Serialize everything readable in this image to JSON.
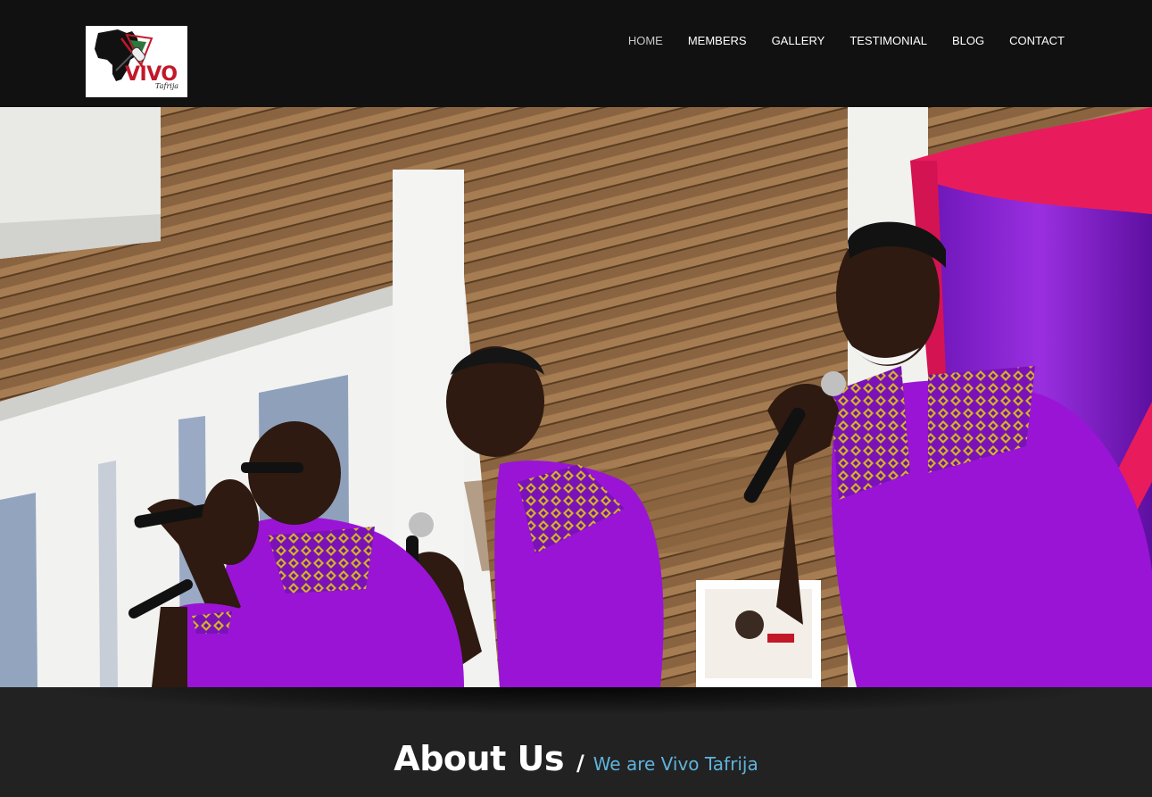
{
  "logo": {
    "brand": "VIVO",
    "sub": "Tafrija"
  },
  "nav": {
    "items": [
      {
        "label": "HOME",
        "active": true
      },
      {
        "label": "MEMBERS",
        "active": false
      },
      {
        "label": "GALLERY",
        "active": false
      },
      {
        "label": "TESTIMONIAL",
        "active": false
      },
      {
        "label": "BLOG",
        "active": false
      },
      {
        "label": "CONTACT",
        "active": false
      }
    ]
  },
  "about": {
    "heading": "About Us",
    "separator": "/",
    "tagline": "We are Vivo Tafrija"
  },
  "colors": {
    "header_bg": "#111111",
    "section_bg": "#222222",
    "accent": "#5fb3dc",
    "logo_red": "#c2182a",
    "shirt_purple": "#9a14d6"
  }
}
